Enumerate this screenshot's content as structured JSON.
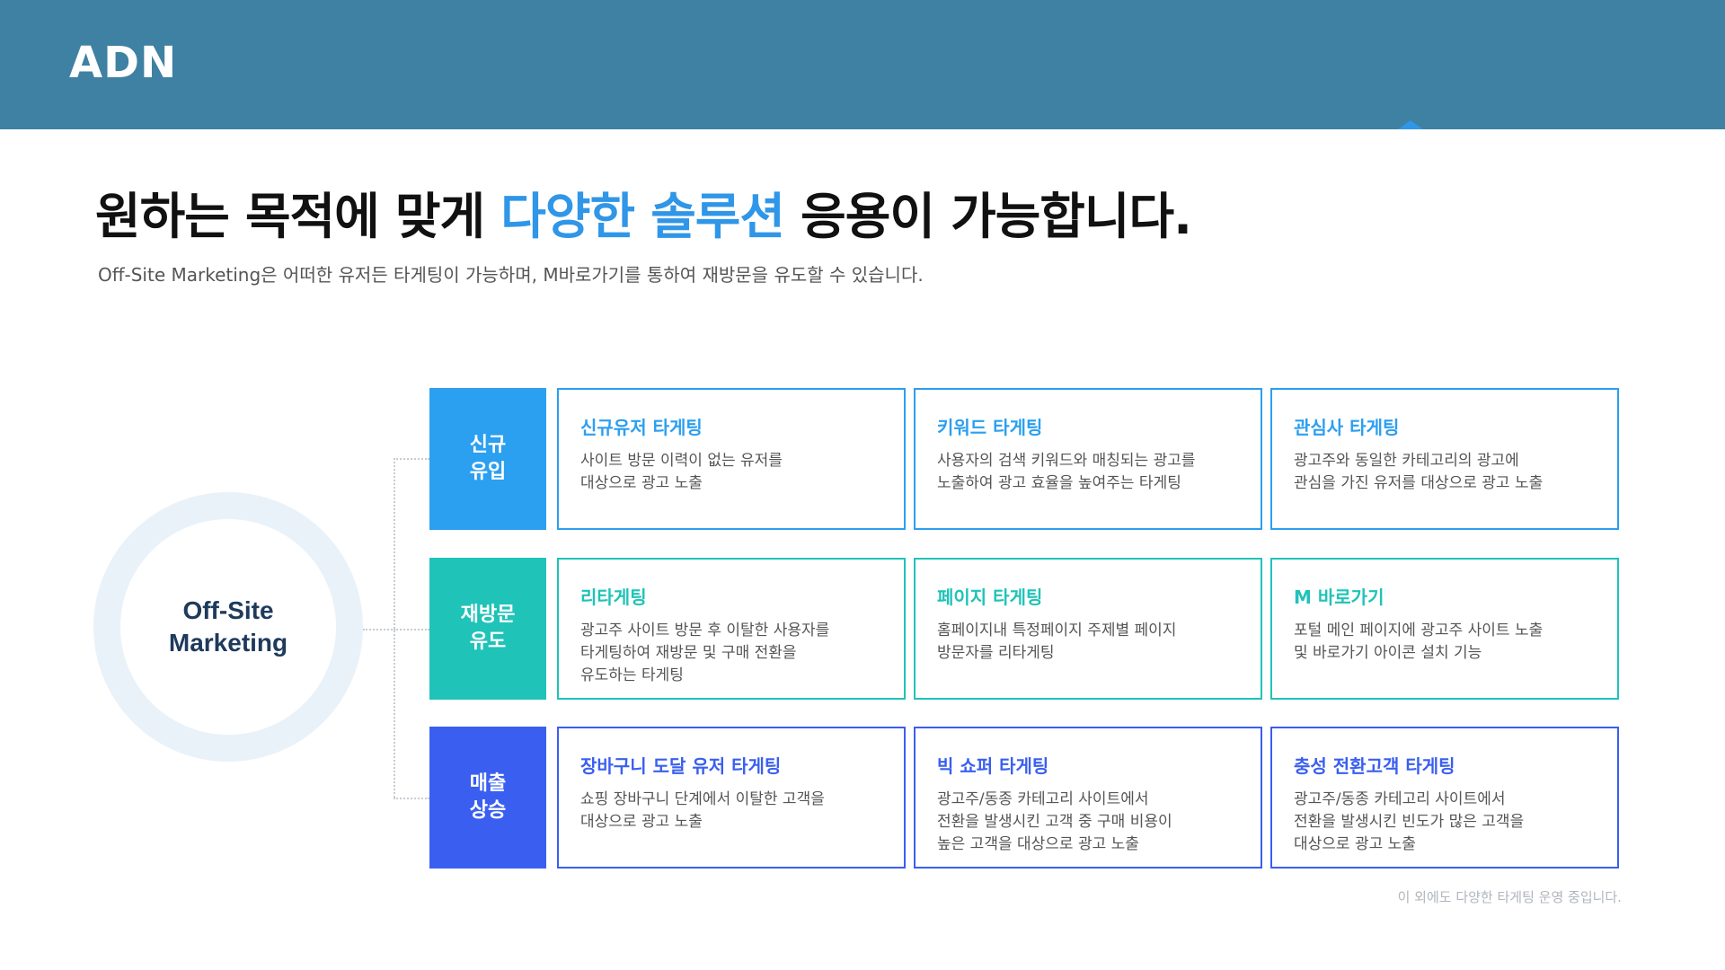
{
  "header": {
    "title": "ADN"
  },
  "headline": {
    "part1": "원하는 목적에 맞게 ",
    "highlight": "다양한 솔루션",
    "part2": " 응용이 가능합니다."
  },
  "subtitle": "Off-Site Marketing은 어떠한 유저든 타게팅이 가능하며, M바로가기를 통하여 재방문을 유도할 수 있습니다.",
  "center": {
    "label": "Off-Site\nMarketing"
  },
  "colors": {
    "header": "#3f81a2",
    "highlight": "#2f96e8"
  },
  "rows": [
    {
      "category": "신규\n유입",
      "color": "#2b9ff0",
      "cards": [
        {
          "title": "신규유저 타게팅",
          "desc": "사이트 방문 이력이 없는 유저를\n대상으로 광고 노출"
        },
        {
          "title": "키워드 타게팅",
          "desc": "사용자의 검색 키워드와 매칭되는 광고를\n노출하여 광고 효율을 높여주는 타게팅"
        },
        {
          "title": "관심사 타게팅",
          "desc": "광고주와 동일한 카테고리의 광고에\n관심을 가진 유저를 대상으로 광고 노출"
        }
      ]
    },
    {
      "category": "재방문\n유도",
      "color": "#1fc3b8",
      "cards": [
        {
          "title": "리타게팅",
          "desc": "광고주 사이트 방문 후 이탈한 사용자를\n타게팅하여 재방문 및 구매 전환을\n유도하는 타게팅"
        },
        {
          "title": "페이지 타게팅",
          "desc": "홈페이지내 특정페이지 주제별 페이지\n방문자를 리타게팅"
        },
        {
          "title": "M 바로가기",
          "desc": "포털 메인 페이지에 광고주 사이트 노출\n및 바로가기 아이콘 설치 기능"
        }
      ]
    },
    {
      "category": "매출\n상승",
      "color": "#3a5ff0",
      "cards": [
        {
          "title": "장바구니 도달 유저 타게팅",
          "desc": "쇼핑 장바구니 단계에서 이탈한 고객을\n대상으로 광고 노출"
        },
        {
          "title": "빅 쇼퍼 타게팅",
          "desc": "광고주/동종 카테고리 사이트에서\n전환을 발생시킨 고객 중 구매 비용이\n높은 고객을 대상으로 광고 노출"
        },
        {
          "title": "충성 전환고객 타게팅",
          "desc": "광고주/동종 카테고리 사이트에서\n전환을 발생시킨 빈도가 많은 고객을\n대상으로 광고 노출"
        }
      ]
    }
  ],
  "footnote": "이 외에도 다양한 타게팅 운영 중입니다."
}
